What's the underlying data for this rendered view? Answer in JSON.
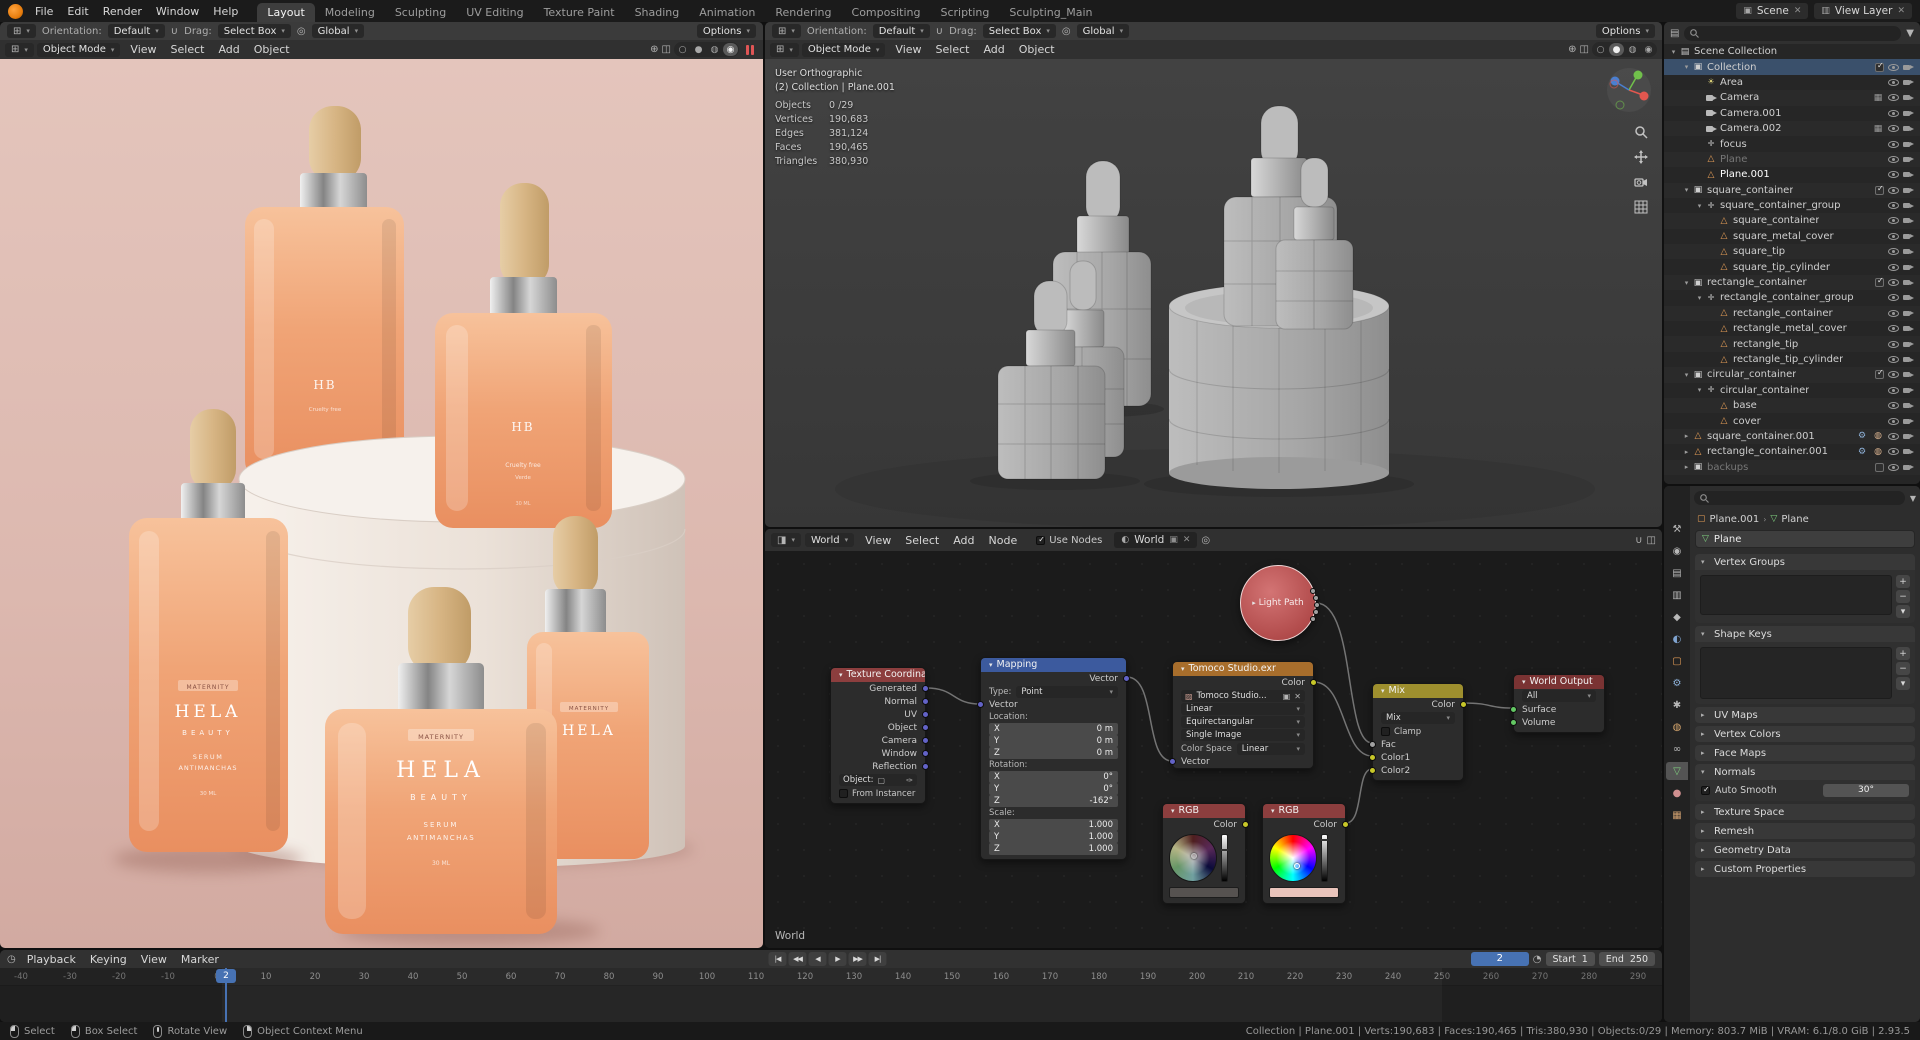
{
  "topbar": {
    "menus": [
      "File",
      "Edit",
      "Render",
      "Window",
      "Help"
    ],
    "tabs": [
      "Layout",
      "Modeling",
      "Sculpting",
      "UV Editing",
      "Texture Paint",
      "Shading",
      "Animation",
      "Rendering",
      "Compositing",
      "Scripting",
      "Sculpting_Main"
    ],
    "active_tab": "Layout",
    "scene": {
      "label": "Scene"
    },
    "view_layer": {
      "label": "View Layer"
    }
  },
  "viewport_left": {
    "tool_row": {
      "orientation_label": "Orientation:",
      "orientation_value": "Default",
      "drag_label": "Drag:",
      "drag_value": "Select Box",
      "pivot_value": "Global",
      "options_label": "Options"
    },
    "header": {
      "mode": "Object Mode",
      "menus": [
        "View",
        "Select",
        "Add",
        "Object"
      ]
    },
    "scene_text": {
      "maternity": "MATERNITY",
      "brand": "HELA",
      "brand_sub": "BEAUTY",
      "line1": "SERUM",
      "line2": "ANTIMANCHAS",
      "volume": "30 ML",
      "hb": "HB",
      "cruelty": "Cruelty free",
      "verde": "Verde"
    }
  },
  "viewport_right": {
    "tool_row": {
      "orientation_label": "Orientation:",
      "orientation_value": "Default",
      "drag_label": "Drag:",
      "drag_value": "Select Box",
      "pivot_value": "Global",
      "options_label": "Options"
    },
    "header": {
      "mode": "Object Mode",
      "menus": [
        "View",
        "Select",
        "Add",
        "Object"
      ]
    },
    "stats": {
      "projection": "User Orthographic",
      "context": "(2) Collection | Plane.001",
      "rows": [
        {
          "label": "Objects",
          "value": "0 /29"
        },
        {
          "label": "Vertices",
          "value": "190,683"
        },
        {
          "label": "Edges",
          "value": "381,124"
        },
        {
          "label": "Faces",
          "value": "190,465"
        },
        {
          "label": "Triangles",
          "value": "380,930"
        }
      ]
    }
  },
  "shader_editor": {
    "header": {
      "shader_type": "World",
      "menus": [
        "View",
        "Select",
        "Add",
        "Node"
      ],
      "use_nodes_label": "Use Nodes",
      "world_name": "World"
    },
    "context_label": "World",
    "nodes": {
      "light_path": {
        "title": "Light Path"
      },
      "texture_coordinate": {
        "title": "Texture Coordinate",
        "outputs": [
          "Generated",
          "Normal",
          "UV",
          "Object",
          "Camera",
          "Window",
          "Reflection"
        ],
        "object_label": "Object:",
        "from_instancer": "From Instancer"
      },
      "mapping": {
        "title": "Mapping",
        "output": "Vector",
        "type_label": "Type:",
        "type_value": "Point",
        "input": "Vector",
        "location_label": "Location:",
        "rotation_label": "Rotation:",
        "scale_label": "Scale:",
        "axis": [
          "X",
          "Y",
          "Z"
        ],
        "location": {
          "x": "0 m",
          "y": "0 m",
          "z": "0 m"
        },
        "rotation": {
          "x": "0°",
          "y": "0°",
          "z": "-162°"
        },
        "scale": {
          "x": "1.000",
          "y": "1.000",
          "z": "1.000"
        }
      },
      "env_texture": {
        "title": "Tomoco Studio.exr",
        "output": "Color",
        "image_name": "Tomoco Studio...",
        "interpolation": "Linear",
        "projection": "Equirectangular",
        "source": "Single Image",
        "color_space_label": "Color Space",
        "color_space_value": "Linear",
        "input": "Vector"
      },
      "rgb1": {
        "title": "RGB",
        "output": "Color",
        "swatch": "#565250"
      },
      "rgb2": {
        "title": "RGB",
        "output": "Color",
        "swatch": "#e9c4bb"
      },
      "mix": {
        "title": "Mix",
        "output": "Color",
        "blend_mode": "Mix",
        "clamp_label": "Clamp",
        "inputs": [
          "Fac",
          "Color1",
          "Color2"
        ]
      },
      "world_output": {
        "title": "World Output",
        "target": "All",
        "inputs": [
          "Surface",
          "Volume"
        ]
      }
    }
  },
  "outliner": {
    "rows": [
      {
        "label": "Scene Collection",
        "level": 0,
        "icon": "scene",
        "arrow": "open"
      },
      {
        "label": "Collection",
        "level": 1,
        "icon": "collection",
        "arrow": "open",
        "selected": true,
        "checkbox": true
      },
      {
        "label": "Area",
        "level": 2,
        "icon": "light"
      },
      {
        "label": "Camera",
        "level": 2,
        "icon": "camera",
        "extras": [
          "screen"
        ]
      },
      {
        "label": "Camera.001",
        "level": 2,
        "icon": "camera"
      },
      {
        "label": "Camera.002",
        "level": 2,
        "icon": "camera",
        "extras": [
          "screen"
        ]
      },
      {
        "label": "focus",
        "level": 2,
        "icon": "empty"
      },
      {
        "label": "Plane",
        "level": 2,
        "icon": "mesh",
        "dim": true
      },
      {
        "label": "Plane.001",
        "level": 2,
        "icon": "mesh",
        "active": true
      },
      {
        "label": "square_container",
        "level": 1,
        "icon": "collection",
        "arrow": "open",
        "checkbox": true
      },
      {
        "label": "square_container_group",
        "level": 2,
        "icon": "empty",
        "arrow": "open"
      },
      {
        "label": "square_container",
        "level": 3,
        "icon": "mesh"
      },
      {
        "label": "square_metal_cover",
        "level": 3,
        "icon": "mesh"
      },
      {
        "label": "square_tip",
        "level": 3,
        "icon": "mesh"
      },
      {
        "label": "square_tip_cylinder",
        "level": 3,
        "icon": "mesh"
      },
      {
        "label": "rectangle_container",
        "level": 1,
        "icon": "collection",
        "arrow": "open",
        "checkbox": true
      },
      {
        "label": "rectangle_container_group",
        "level": 2,
        "icon": "empty",
        "arrow": "open"
      },
      {
        "label": "rectangle_container",
        "level": 3,
        "icon": "mesh"
      },
      {
        "label": "rectangle_metal_cover",
        "level": 3,
        "icon": "mesh"
      },
      {
        "label": "rectangle_tip",
        "level": 3,
        "icon": "mesh"
      },
      {
        "label": "rectangle_tip_cylinder",
        "level": 3,
        "icon": "mesh"
      },
      {
        "label": "circular_container",
        "level": 1,
        "icon": "collection",
        "arrow": "open",
        "checkbox": true
      },
      {
        "label": "circular_container",
        "level": 2,
        "icon": "empty",
        "arrow": "open"
      },
      {
        "label": "base",
        "level": 3,
        "icon": "mesh"
      },
      {
        "label": "cover",
        "level": 3,
        "icon": "mesh"
      },
      {
        "label": "square_container.001",
        "level": 1,
        "icon": "mesh",
        "arrow": "closed",
        "extras": [
          "wrench",
          "physics"
        ]
      },
      {
        "label": "rectangle_container.001",
        "level": 1,
        "icon": "mesh",
        "arrow": "closed",
        "extras": [
          "wrench",
          "physics"
        ]
      },
      {
        "label": "backups",
        "level": 1,
        "icon": "collection",
        "arrow": "closed",
        "dim": true,
        "checkbox": true,
        "checkbox_unchecked": true
      }
    ]
  },
  "properties": {
    "breadcrumb": {
      "object": "Plane.001",
      "data": "Plane"
    },
    "name_field": "Plane",
    "panels": [
      {
        "title": "Vertex Groups",
        "kind": "list"
      },
      {
        "title": "Shape Keys",
        "kind": "list"
      },
      {
        "title": "UV Maps",
        "kind": "collapsed"
      },
      {
        "title": "Vertex Colors",
        "kind": "collapsed"
      },
      {
        "title": "Face Maps",
        "kind": "collapsed"
      },
      {
        "title": "Normals",
        "kind": "normals",
        "auto_smooth_label": "Auto Smooth",
        "angle_value": "30°"
      },
      {
        "title": "Texture Space",
        "kind": "collapsed"
      },
      {
        "title": "Remesh",
        "kind": "collapsed"
      },
      {
        "title": "Geometry Data",
        "kind": "collapsed"
      },
      {
        "title": "Custom Properties",
        "kind": "collapsed"
      }
    ]
  },
  "timeline": {
    "menus": [
      "Playback",
      "Keying",
      "View",
      "Marker"
    ],
    "transport": [
      "|◀",
      "◀◀",
      "◀",
      "▶",
      "▶▶",
      "▶|"
    ],
    "current_frame": "2",
    "start_label": "Start",
    "start_value": "1",
    "end_label": "End",
    "end_value": "250",
    "ruler": {
      "start": -40,
      "end": 290,
      "step": 10
    }
  },
  "statusbar": {
    "hints": [
      {
        "button": "left",
        "label": "Select"
      },
      {
        "button": "left",
        "label": "Box Select"
      },
      {
        "button": "middle",
        "label": "Rotate View"
      },
      {
        "button": "right",
        "label": "Object Context Menu"
      }
    ],
    "info": "Collection | Plane.001 | Verts:190,683 | Faces:190,465 | Tris:380,930 | Objects:0/29 | Memory: 803.7 MiB | VRAM: 6.1/8.0 GiB | 2.93.5"
  },
  "colors": {
    "accent": "#4772b3",
    "header_texcoord": "#8c3e3e",
    "header_mapping": "#3c5a9e",
    "header_envtex": "#a86e2c",
    "header_rgb": "#8c3e3e",
    "header_mix": "#9e8f2e",
    "header_output": "#7a3333"
  }
}
